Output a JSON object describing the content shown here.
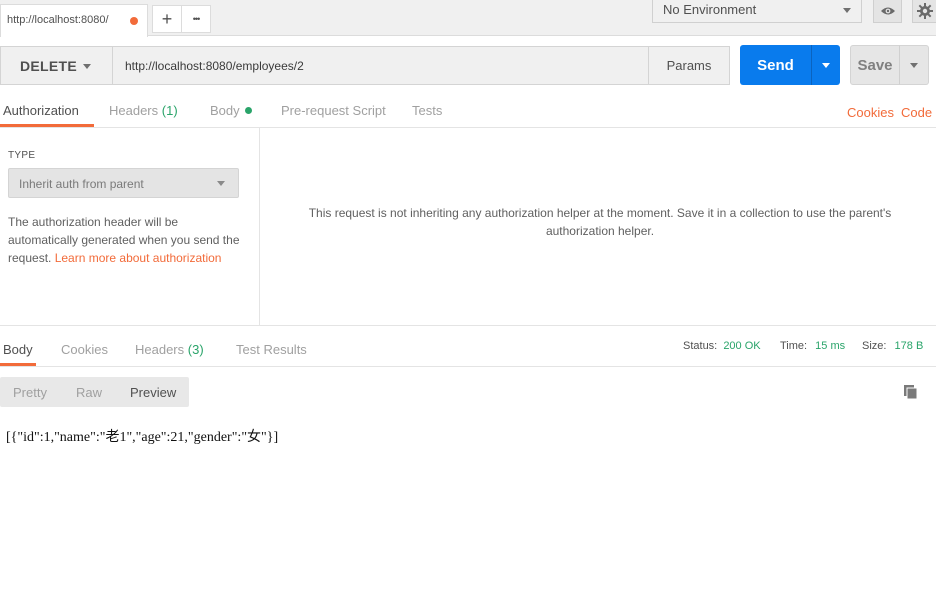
{
  "tabbar": {
    "request_tab_label": "http://localhost:8080/",
    "add_tab_symbol": "+",
    "more_tabs_symbol": "•••"
  },
  "environment": {
    "selected": "No Environment"
  },
  "request": {
    "method": "DELETE",
    "url": "http://localhost:8080/employees/2",
    "params_label": "Params",
    "send_label": "Send",
    "save_label": "Save"
  },
  "request_tabs": {
    "authorization": "Authorization",
    "headers": "Headers",
    "headers_count": "(1)",
    "body": "Body",
    "pre_request_script": "Pre-request Script",
    "tests": "Tests",
    "cookies": "Cookies",
    "code": "Code"
  },
  "auth": {
    "type_label": "TYPE",
    "type_value": "Inherit auth from parent",
    "description": "The authorization header will be automatically generated when you send the request. ",
    "learn_more_link": "Learn more about authorization",
    "message": "This request is not inheriting any authorization helper at the moment. Save it in a collection to use the parent's authorization helper."
  },
  "response": {
    "tabs": {
      "body": "Body",
      "cookies": "Cookies",
      "headers": "Headers",
      "headers_count": "(3)",
      "test_results": "Test Results"
    },
    "status_label": "Status:",
    "status_value": "200 OK",
    "time_label": "Time:",
    "time_value": "15 ms",
    "size_label": "Size:",
    "size_value": "178 B",
    "views": {
      "pretty": "Pretty",
      "raw": "Raw",
      "preview": "Preview"
    },
    "body_text": "[{\"id\":1,\"name\":\"老1\",\"age\":21,\"gender\":\"女\"}]"
  },
  "colors": {
    "accent_orange": "#f26b3a",
    "send_blue": "#097bed",
    "status_green": "#2aa46a"
  },
  "icons": [
    "unsaved-dot-icon",
    "plus-icon",
    "more-icon",
    "chevron-down-icon",
    "eye-icon",
    "gear-icon",
    "copy-icon"
  ]
}
